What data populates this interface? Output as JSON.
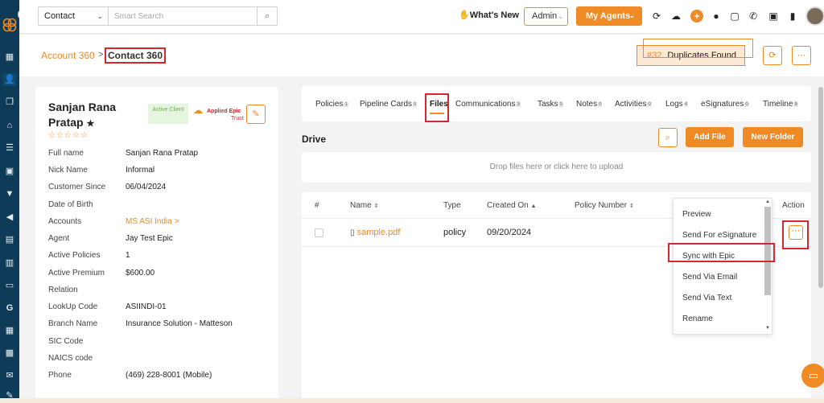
{
  "nav": {
    "rail_icons": [
      "dashboard-icon",
      "contacts-icon",
      "copy-icon",
      "institution-icon",
      "list-icon",
      "id-card-icon",
      "filter-icon",
      "megaphone-icon",
      "document-icon",
      "analytics-icon",
      "folder-icon",
      "google-icon",
      "calculator-icon",
      "calendar-icon",
      "mail-icon",
      "signature-icon"
    ],
    "search_scope": "Contact",
    "search_placeholder": "Smart Search",
    "whats_new": "What's New",
    "admin_label": "Admin",
    "agents_label": "My Agents"
  },
  "breadcrumb": {
    "parent": "Account 360",
    "separator": ">",
    "current": "Contact 360"
  },
  "duplicates": {
    "count": "#32",
    "label": "Duplicates Found"
  },
  "contact": {
    "name": "Sanjan Rana Pratap",
    "star": "★",
    "rating": "☆☆☆☆☆",
    "status_badge": "Active Client",
    "epic_badge": "Applied Epic",
    "epic_sub": "Trust",
    "fields": [
      {
        "label": "Full name",
        "value": "Sanjan Rana Pratap"
      },
      {
        "label": "Nick Name",
        "value": "Informal"
      },
      {
        "label": "Customer Since",
        "value": "06/04/2024"
      },
      {
        "label": "Date of Birth",
        "value": ""
      },
      {
        "label": "Accounts",
        "value": "MS ASI India >"
      },
      {
        "label": "Agent",
        "value": "Jay Test Epic"
      },
      {
        "label": "Active Policies",
        "value": "1"
      },
      {
        "label": "Active Premium",
        "value": "$600.00"
      },
      {
        "label": "Relation",
        "value": ""
      },
      {
        "label": "LookUp Code",
        "value": "ASIINDI-01"
      },
      {
        "label": "Branch Name",
        "value": "Insurance Solution - Matteson"
      },
      {
        "label": "SIC Code",
        "value": ""
      },
      {
        "label": "NAICS code",
        "value": ""
      },
      {
        "label": "Phone",
        "value": "(469) 228-8001 (Mobile)"
      }
    ]
  },
  "tabs": [
    {
      "label": "Policies",
      "count": "1"
    },
    {
      "label": "Pipeline Cards",
      "count": "0"
    },
    {
      "label": "Files",
      "count": ""
    },
    {
      "label": "Communications",
      "count": "3"
    },
    {
      "label": "Tasks",
      "count": "0"
    },
    {
      "label": "Notes",
      "count": "0"
    },
    {
      "label": "Activities",
      "count": "0"
    },
    {
      "label": "Logs",
      "count": "4"
    },
    {
      "label": "eSignatures",
      "count": "0"
    },
    {
      "label": "Timeline",
      "count": "9"
    }
  ],
  "drive": {
    "title": "Drive",
    "add_file": "Add File",
    "new_folder": "New Folder",
    "dropzone": "Drop files here or click here to upload"
  },
  "table": {
    "headers": {
      "num": "#",
      "name": "Name",
      "type": "Type",
      "created": "Created On",
      "policy": "Policy Number",
      "action": "Action"
    },
    "rows": [
      {
        "name": "sample.pdf",
        "type": "policy",
        "created": "09/20/2024",
        "policy": ""
      }
    ]
  },
  "menu": {
    "items": [
      "Preview",
      "Send For eSignature",
      "Sync with Epic",
      "Send Via Email",
      "Send Via Text",
      "Rename"
    ]
  },
  "colors": {
    "accent": "#f08a24",
    "rail": "#0e3b57",
    "highlight": "#d62630"
  }
}
